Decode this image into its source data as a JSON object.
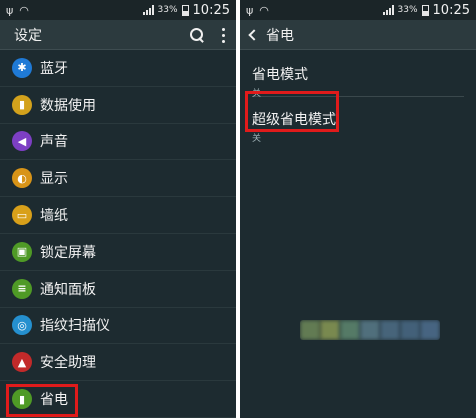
{
  "status": {
    "battery": "33%",
    "time": "10:25"
  },
  "left": {
    "title": "设定",
    "items": [
      {
        "label": "蓝牙",
        "icon": "bluetooth-icon",
        "color": "#1f7ad6",
        "glyph": "✱"
      },
      {
        "label": "数据使用",
        "icon": "data-usage-icon",
        "color": "#d3a21c",
        "glyph": "▮"
      },
      {
        "label": "声音",
        "icon": "sound-icon",
        "color": "#7d3fc4",
        "glyph": "◀"
      },
      {
        "label": "显示",
        "icon": "display-icon",
        "color": "#d89418",
        "glyph": "◐"
      },
      {
        "label": "墙纸",
        "icon": "wallpaper-icon",
        "color": "#d8a01a",
        "glyph": "▭"
      },
      {
        "label": "锁定屏幕",
        "icon": "lock-screen-icon",
        "color": "#4f9a26",
        "glyph": "▣"
      },
      {
        "label": "通知面板",
        "icon": "notification-panel-icon",
        "color": "#4f9a26",
        "glyph": "≡"
      },
      {
        "label": "指纹扫描仪",
        "icon": "fingerprint-icon",
        "color": "#2590cf",
        "glyph": "◎"
      },
      {
        "label": "安全助理",
        "icon": "safety-assistance-icon",
        "color": "#c22a2a",
        "glyph": "▲"
      },
      {
        "label": "省电",
        "icon": "power-saving-icon",
        "color": "#4f9a26",
        "glyph": "▮"
      }
    ]
  },
  "right": {
    "title": "省电",
    "settings": [
      {
        "label": "省电模式",
        "value": "关"
      },
      {
        "label": "超级省电模式",
        "value": "关"
      }
    ]
  },
  "colors": {
    "highlight": "#e01b1b",
    "background": "#1d2b30"
  }
}
